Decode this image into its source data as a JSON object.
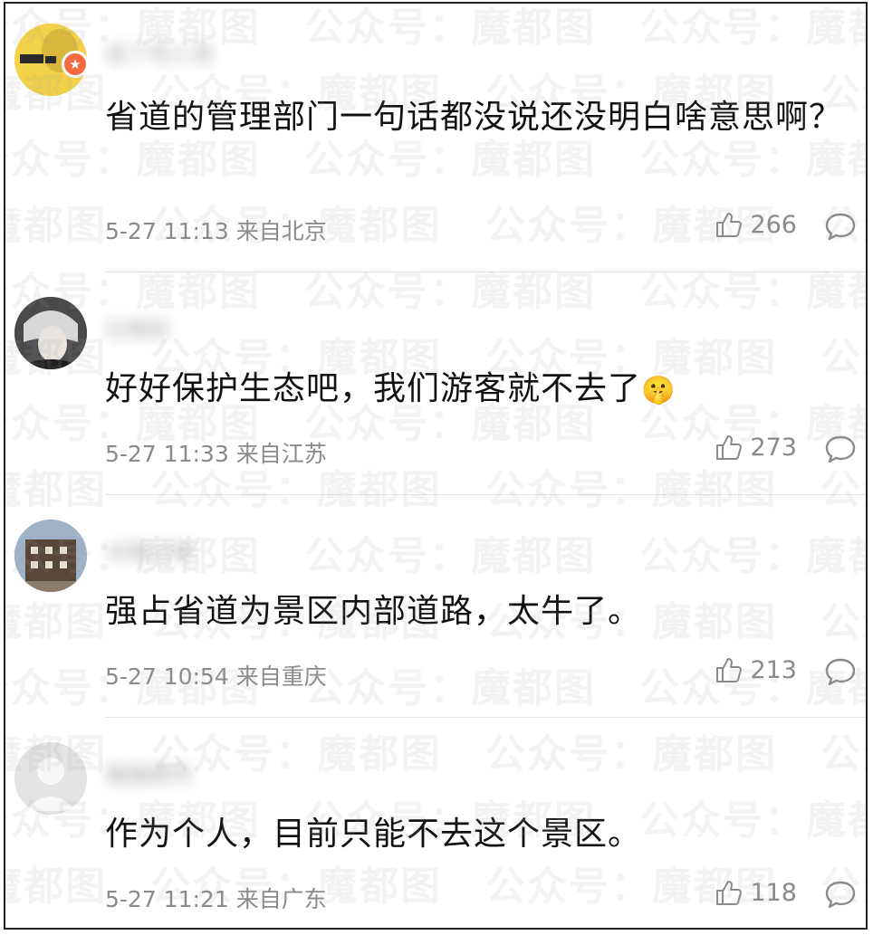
{
  "watermark_text": "公众号：魔都图",
  "comments": [
    {
      "username": "戒了吧人类",
      "text": "省道的管理部门一句话都没说还没明白啥意思啊？",
      "time": "5-27 11:13",
      "location": "来自北京",
      "likes": "266"
    },
    {
      "username": "位梅妖",
      "text": "好好保护生态吧，我们游客就不去了",
      "emoji": "🤫",
      "time": "5-27 11:33",
      "location": "来自江苏",
      "likes": "273"
    },
    {
      "username": "冰瓶江骑",
      "text": "强占省道为景区内部道路，太牛了。",
      "time": "5-27 10:54",
      "location": "来自重庆",
      "likes": "213"
    },
    {
      "username": "猫猫鼎鸡",
      "text": "作为个人，目前只能不去这个景区。",
      "time": "5-27 11:21",
      "location": "来自广东",
      "likes": "118"
    }
  ],
  "icons": {
    "like": "thumbs-up-icon",
    "reply": "comment-bubble-icon",
    "badge": "verified-star-icon"
  },
  "colors": {
    "badge": "#f26a3d",
    "meta_text": "#8a8a8a",
    "body_text": "#111111"
  }
}
